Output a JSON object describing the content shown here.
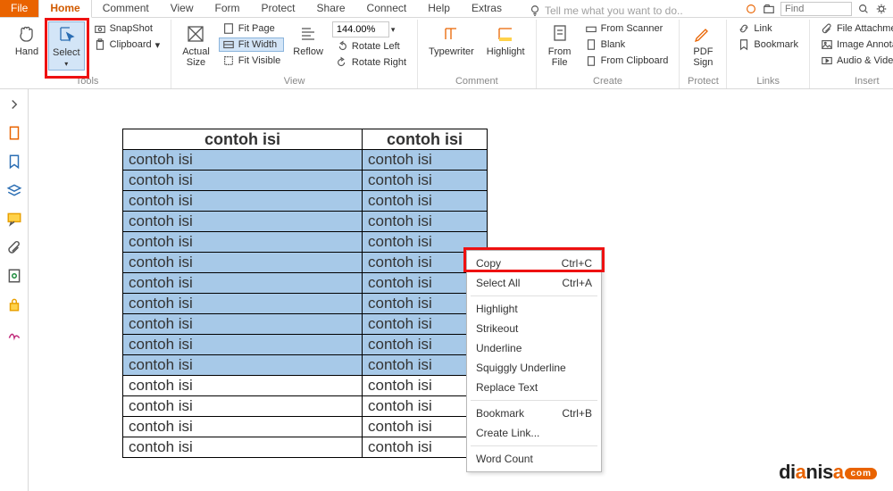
{
  "tabs": [
    "File",
    "Home",
    "Comment",
    "View",
    "Form",
    "Protect",
    "Share",
    "Connect",
    "Help",
    "Extras"
  ],
  "active_tab": "Home",
  "tellme_placeholder": "Tell me what you want to do..",
  "find_placeholder": "Find",
  "ribbon": {
    "tools": {
      "hand": "Hand",
      "select": "Select",
      "snapshot": "SnapShot",
      "clipboard": "Clipboard",
      "label": "Tools"
    },
    "view": {
      "actual": "Actual\nSize",
      "fitpage": "Fit Page",
      "fitwidth": "Fit Width",
      "fitvisible": "Fit Visible",
      "reflow": "Reflow",
      "zoom": "144.00%",
      "rotl": "Rotate Left",
      "rotr": "Rotate Right",
      "label": "View"
    },
    "comment": {
      "type": "Typewriter",
      "hl": "Highlight",
      "label": "Comment"
    },
    "create": {
      "file": "From\nFile",
      "scanner": "From Scanner",
      "blank": "Blank",
      "clip": "From Clipboard",
      "label": "Create"
    },
    "protect": {
      "sign": "PDF\nSign",
      "label": "Protect"
    },
    "links": {
      "link": "Link",
      "bm": "Bookmark",
      "label": "Links"
    },
    "insert": {
      "fa": "File Attachment",
      "ia": "Image Annotation",
      "av": "Audio & Video",
      "label": "Insert"
    }
  },
  "table": {
    "header": [
      "contoh isi",
      "contoh isi"
    ],
    "rows": 15,
    "cell": "contoh isi",
    "selected_rows": 11
  },
  "context_menu": [
    {
      "label": "Copy",
      "shortcut": "Ctrl+C",
      "hl": true
    },
    {
      "label": "Select All",
      "shortcut": "Ctrl+A"
    },
    {
      "sep": true
    },
    {
      "label": "Highlight"
    },
    {
      "label": "Strikeout"
    },
    {
      "label": "Underline"
    },
    {
      "label": "Squiggly Underline"
    },
    {
      "label": "Replace Text"
    },
    {
      "sep": true
    },
    {
      "label": "Bookmark",
      "shortcut": "Ctrl+B"
    },
    {
      "label": "Create Link..."
    },
    {
      "sep": true
    },
    {
      "label": "Word Count"
    }
  ],
  "watermark": {
    "brand": "dianisa",
    "suffix": "com"
  }
}
